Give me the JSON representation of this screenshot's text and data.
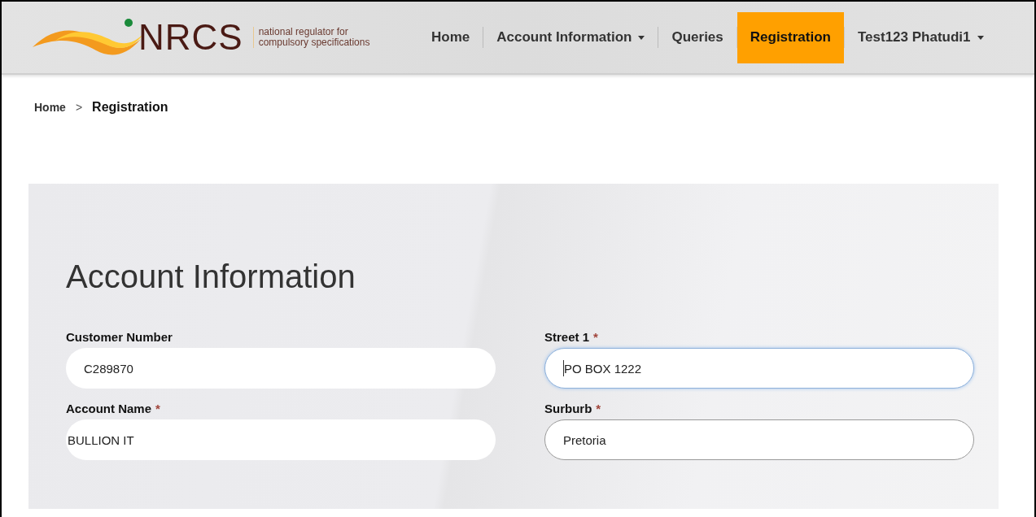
{
  "logo": {
    "name": "NRCS",
    "tagline": [
      "national regulator for",
      "compulsory specifications"
    ]
  },
  "nav": [
    {
      "label": "Home",
      "dropdown": false,
      "selected": false
    },
    {
      "label": "Account Information",
      "dropdown": true,
      "selected": false
    },
    {
      "label": "Queries",
      "dropdown": false,
      "selected": false
    },
    {
      "label": "Registration",
      "dropdown": false,
      "selected": true
    },
    {
      "label": "Test123 Phatudi1",
      "dropdown": true,
      "selected": false
    }
  ],
  "breadcrumb": {
    "items": [
      "Home",
      "Registration"
    ],
    "separator": ">"
  },
  "form": {
    "title": "Account Information",
    "fields": [
      {
        "label": "Customer Number",
        "required": false,
        "value": "C289870",
        "focused": false
      },
      {
        "label": "Street 1",
        "required": true,
        "value": "PO BOX 1222",
        "focused": true
      },
      {
        "label": "Account Name",
        "required": true,
        "value": "BULLION IT",
        "focused": false
      },
      {
        "label": "Surburb",
        "required": true,
        "value": "Pretoria",
        "focused": false
      }
    ],
    "required_mark": "*"
  }
}
